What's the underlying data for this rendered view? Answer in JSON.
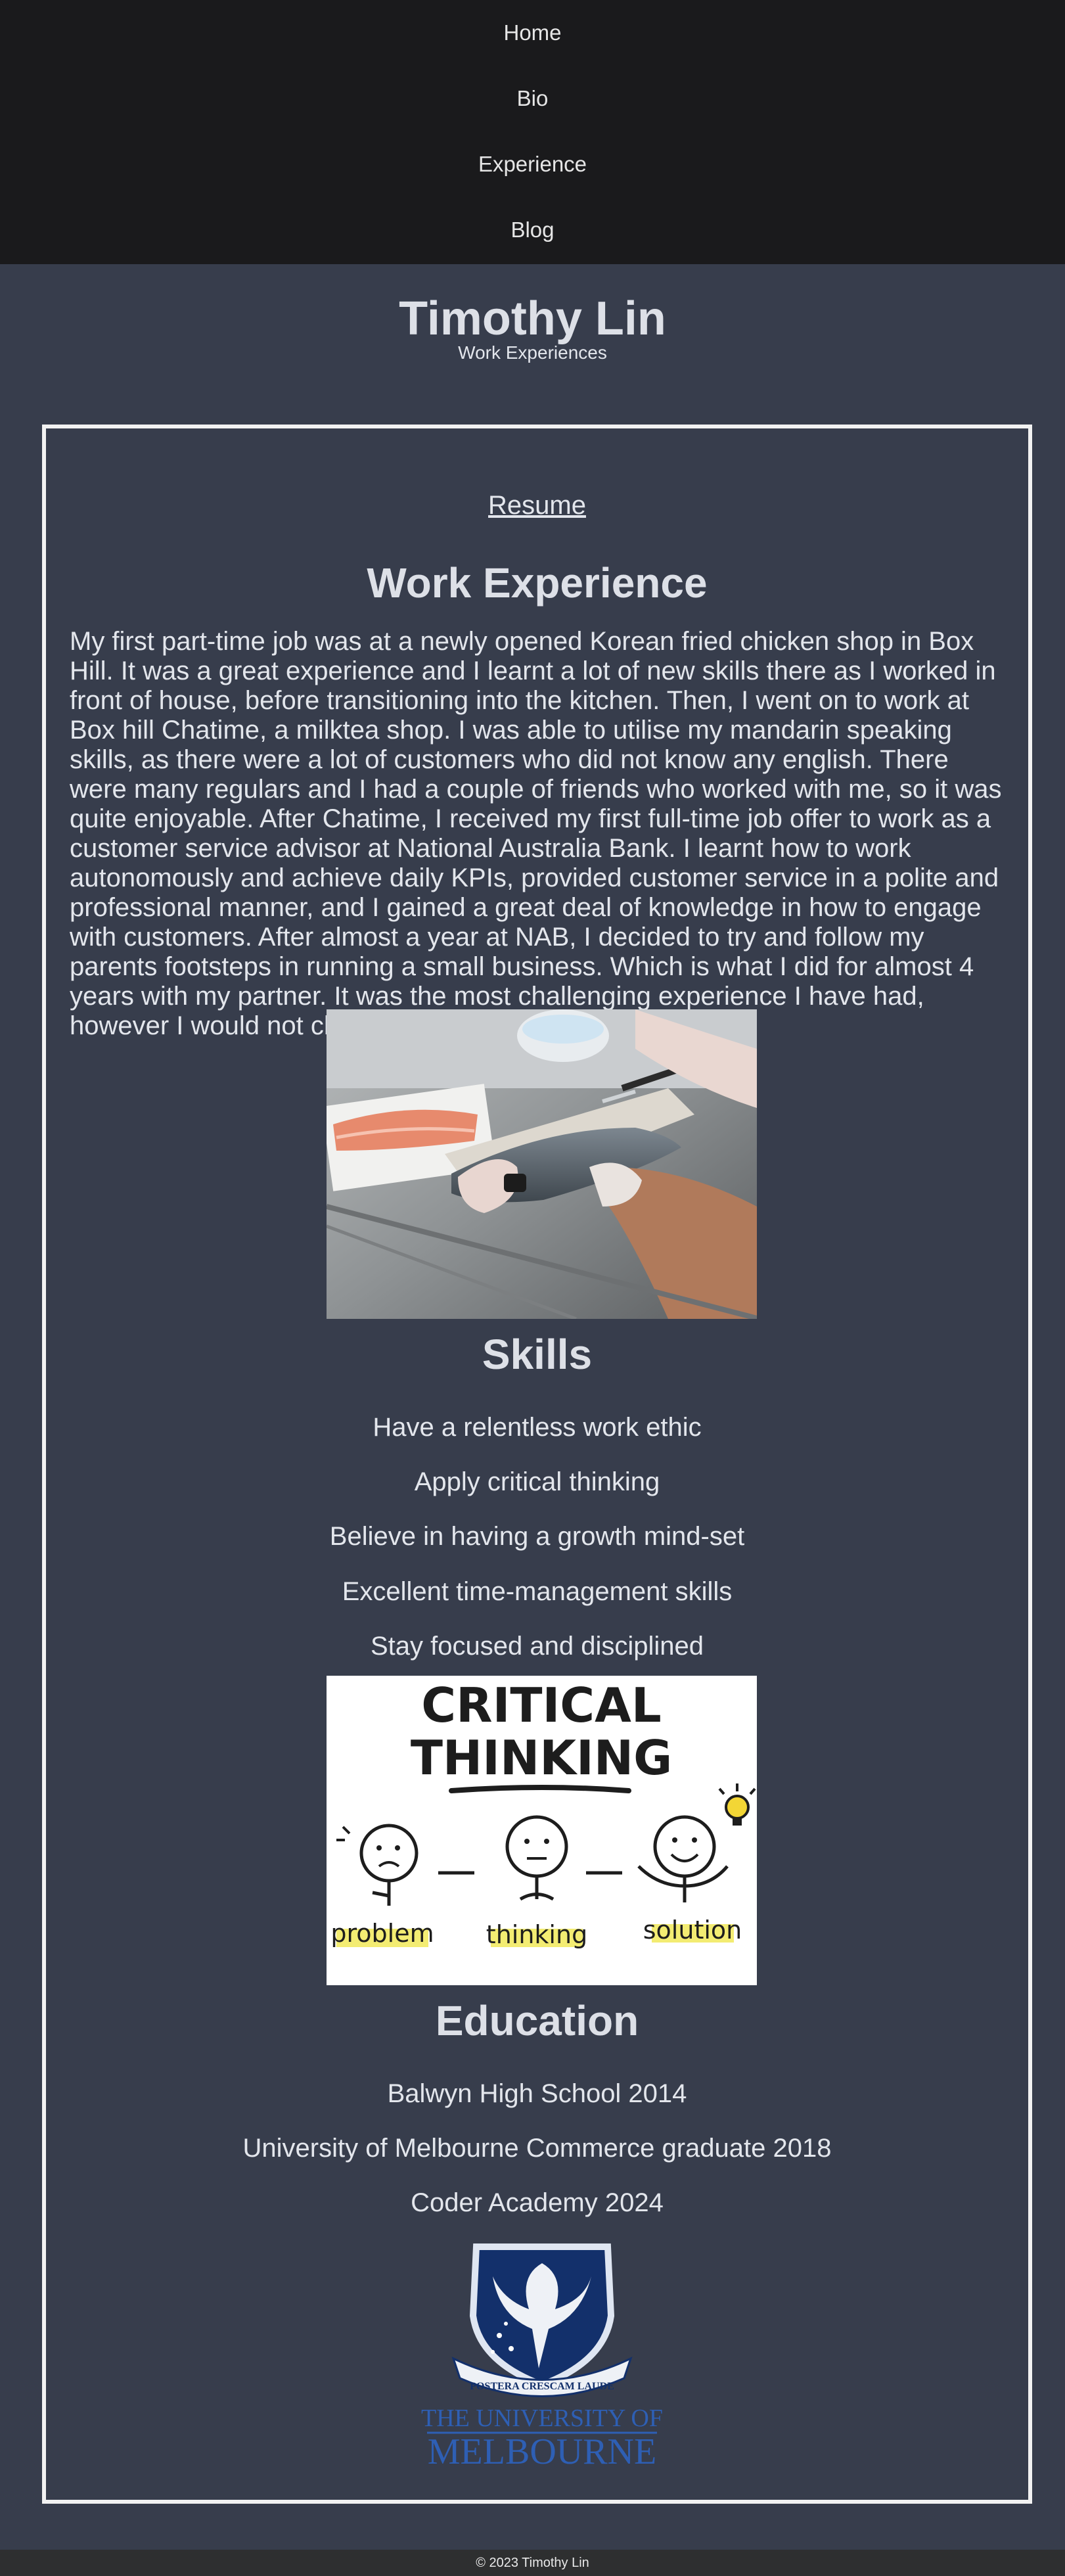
{
  "nav": {
    "items": [
      "Home",
      "Bio",
      "Experience",
      "Blog"
    ]
  },
  "header": {
    "title": "Timothy Lin",
    "subtitle": "Work Experiences"
  },
  "main": {
    "resume_link": "Resume",
    "work": {
      "heading": "Work Experience",
      "text": "My first part-time job was at a newly opened Korean fried chicken shop in Box Hill. It was a great experience and I learnt a lot of new skills there as I worked in front of house, before transitioning into the kitchen. Then, I went on to work at Box hill Chatime, a milktea shop. I was able to utilise my mandarin speaking skills, as there were a lot of customers who did not know any english. There were many regulars and I had a couple of friends who worked with me, so it was quite enjoyable. After Chatime, I received my first full-time job offer to work as a customer service advisor at National Australia Bank. I learnt how to work autonomously and achieve daily KPIs, provided customer service in a polite and professional manner, and I gained a great deal of knowledge in how to engage with customers. After almost a year at NAB, I decided to try and follow my parents footsteps in running a small business. Which is what I did for almost 4 years with my partner. It was the most challenging experience I have had, however I would not change it for anything."
    },
    "skills": {
      "heading": "Skills",
      "items": [
        "Have a relentless work ethic",
        "Apply critical thinking",
        "Believe in having a growth mind-set",
        "Excellent time-management skills",
        "Stay focused and disciplined"
      ]
    },
    "critical_image": {
      "line1": "CRITICAL",
      "line2": "THINKING",
      "labels": [
        "problem",
        "thinking",
        "solution"
      ]
    },
    "education": {
      "heading": "Education",
      "items": [
        "Balwyn High School 2014",
        "University of Melbourne Commerce graduate 2018",
        "Coder Academy 2024"
      ]
    },
    "logo": {
      "motto": "POSTERA CRESCAM LAUDE",
      "line1": "THE UNIVERSITY OF",
      "line2": "MELBOURNE"
    }
  },
  "footer": {
    "text": "© 2023 Timothy Lin"
  },
  "colors": {
    "background": "#373d4c",
    "nav": "#1a1a1c",
    "text": "#e3e6ec",
    "border": "#f2f2f2"
  }
}
